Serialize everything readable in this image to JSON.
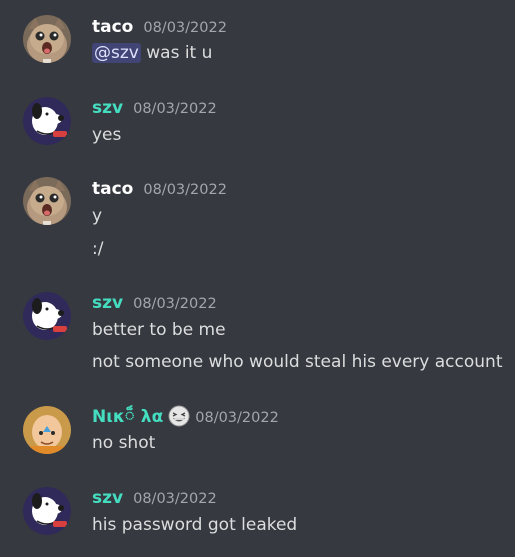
{
  "colors": {
    "background": "#36393f",
    "text": "#dcddde",
    "timestamp": "#a3a6aa",
    "taco_name": "#ffffff",
    "szv_name": "#45ddc0",
    "nik_name": "#45ddc0",
    "mention_bg": "#5865f24d"
  },
  "messages": [
    {
      "author": "taco",
      "timestamp": "08/03/2022",
      "avatar": "cat-avatar",
      "lines": [
        {
          "mention": "@szv",
          "text": " was it u"
        }
      ]
    },
    {
      "author": "szv",
      "timestamp": "08/03/2022",
      "avatar": "snoopy-avatar",
      "lines": [
        {
          "text": "yes"
        }
      ]
    },
    {
      "author": "taco",
      "timestamp": "08/03/2022",
      "avatar": "cat-avatar",
      "lines": [
        {
          "text": "y"
        },
        {
          "text": ":/"
        }
      ]
    },
    {
      "author": "szv",
      "timestamp": "08/03/2022",
      "avatar": "snoopy-avatar",
      "lines": [
        {
          "text": "better to be me"
        },
        {
          "text": "not someone who would steal his every account"
        }
      ]
    },
    {
      "author": "Νικ៏ λα",
      "author_emoji": "grinning-squinting-face",
      "timestamp": "08/03/2022",
      "avatar": "aang-avatar",
      "lines": [
        {
          "text": "no shot"
        }
      ]
    },
    {
      "author": "szv",
      "timestamp": "08/03/2022",
      "avatar": "snoopy-avatar",
      "lines": [
        {
          "text": "his password got leaked"
        }
      ]
    }
  ]
}
